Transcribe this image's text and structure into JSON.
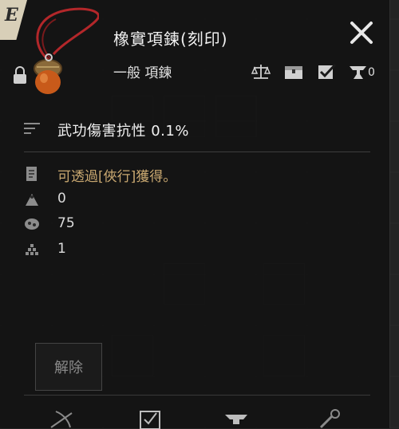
{
  "item": {
    "grade_letter": "E",
    "name": "橡實項鍊(刻印)",
    "type": "一般 項鍊",
    "stat": "武功傷害抗性 0.1%",
    "source": "可透過[俠行]獲得。",
    "values": [
      "0",
      "75",
      "1"
    ]
  },
  "actions": {
    "count": "0",
    "icons": [
      "balance-scale-icon",
      "chest-icon",
      "checkbox-icon",
      "anvil-icon"
    ]
  },
  "background": {
    "button_label": "解除"
  },
  "colors": {
    "accent_gold": "#c9a870",
    "panel": "#121212"
  }
}
